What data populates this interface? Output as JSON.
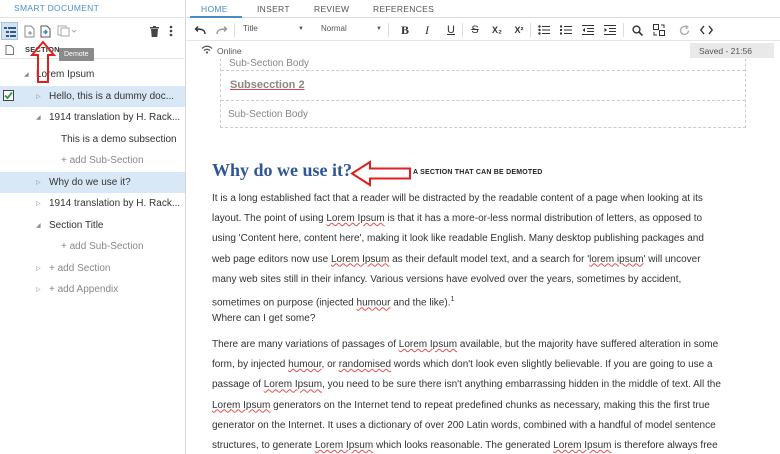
{
  "left_panel": {
    "header": "SMART DOCUMENT",
    "tooltip": "Demote",
    "column_header": "SECTION",
    "tree": [
      {
        "label": "Lorem Ipsum",
        "level": 0,
        "expanded": true
      },
      {
        "label": "Hello, this is a dummy doc...",
        "level": 1,
        "checked": true,
        "selected": true
      },
      {
        "label": "1914 translation by H. Rack...",
        "level": 1,
        "expanded": true
      },
      {
        "label": "This is a demo subsection",
        "level": 2
      },
      {
        "label": "+ add Sub-Section",
        "level": 2,
        "add": true
      },
      {
        "label": "Why do we use it?",
        "level": 1,
        "selected": true
      },
      {
        "label": "1914 translation by H. Rack...",
        "level": 1
      },
      {
        "label": "Section Title",
        "level": 1,
        "expanded": true
      },
      {
        "label": "+ add Sub-Section",
        "level": 2,
        "add": true
      },
      {
        "label": "+ add Section",
        "level": 1,
        "add": true
      },
      {
        "label": "+ add Appendix",
        "level": 1,
        "add": true
      }
    ]
  },
  "menu": {
    "tabs": [
      "HOME",
      "INSERT",
      "REVIEW",
      "REFERENCES"
    ],
    "active": "HOME"
  },
  "toolbar": {
    "style_select": "Title",
    "size_select": "Normal",
    "bold": "B",
    "italic": "I",
    "underline": "U",
    "strike": "S",
    "subscript": "X₂",
    "superscript": "X²"
  },
  "status": {
    "connection": "Online",
    "saved": "Saved - 21:56"
  },
  "document": {
    "subsection_body_1": "Sub-Section Body",
    "subsection_2_title": "Subsecction 2",
    "subsection_body_2": "Sub-Section Body",
    "heading": "Why do we use it?",
    "annotation": "A SECTION THAT CAN BE DEMOTED",
    "para1": [
      "It is a long established fact that a reader will be distracted by the readable content of a page when looking at its",
      "layout. The point of using ",
      "Lorem Ipsum",
      " is that it has a more-or-less normal distribution of letters, as opposed to",
      "using 'Content here, content here', making it look like readable English. Many desktop publishing packages and",
      "web page editors now use ",
      "Lorem Ipsum",
      " as their default model text, and a search for '",
      "lorem ipsum",
      "' will uncover",
      "many web sites still in their infancy. Various versions have evolved over the years, sometimes by accident,",
      "sometimes on purpose (injected ",
      "humour",
      " and the like).",
      "1"
    ],
    "para2": "Where can I get some?",
    "para3": [
      "There are many variations of passages of ",
      "Lorem Ipsum",
      " available, but the majority have suffered alteration in some",
      "form, by injected ",
      "humour",
      ", or ",
      "randomised",
      " words which don't look even slightly believable. If you are going to use a",
      "passage of ",
      "Lorem Ipsum",
      ", you need to be sure there isn't anything embarrassing hidden in the middle of text. All the",
      "Lorem Ipsum",
      " generators on the Internet tend to repeat predefined chunks as necessary, making this the first true",
      "generator on the Internet. It uses a dictionary of over 200 Latin words, combined with a handful of model sentence",
      "structures, to generate ",
      "Lorem Ipsum",
      " which looks reasonable. The generated ",
      "Lorem Ipsum",
      " is therefore always free"
    ]
  },
  "colors": {
    "accent": "#4a8ac8",
    "heading": "#2f5597",
    "selection": "#d9e8f6",
    "annotation_arrow": "#e02020"
  }
}
